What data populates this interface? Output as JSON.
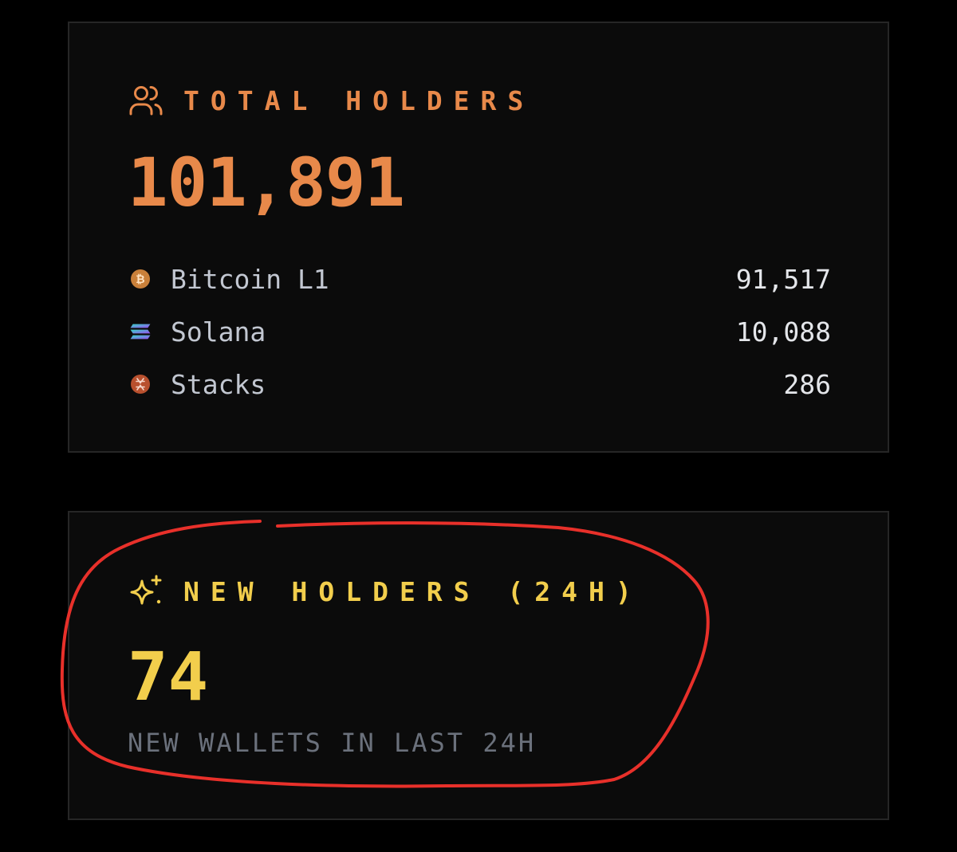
{
  "total_holders": {
    "title": "TOTAL HOLDERS",
    "icon": "users-icon",
    "value": "101,891",
    "accent_color": "#e8894a",
    "chains": [
      {
        "name": "Bitcoin L1",
        "value": "91,517",
        "icon": "bitcoin-icon"
      },
      {
        "name": "Solana",
        "value": "10,088",
        "icon": "solana-icon"
      },
      {
        "name": "Stacks",
        "value": "286",
        "icon": "stacks-icon"
      }
    ]
  },
  "new_holders": {
    "title": "NEW HOLDERS (24H)",
    "icon": "sparkles-icon",
    "value": "74",
    "subtitle": "NEW WALLETS IN LAST 24H",
    "accent_color": "#f2ce4c"
  },
  "annotation": {
    "color": "#e8302a"
  }
}
